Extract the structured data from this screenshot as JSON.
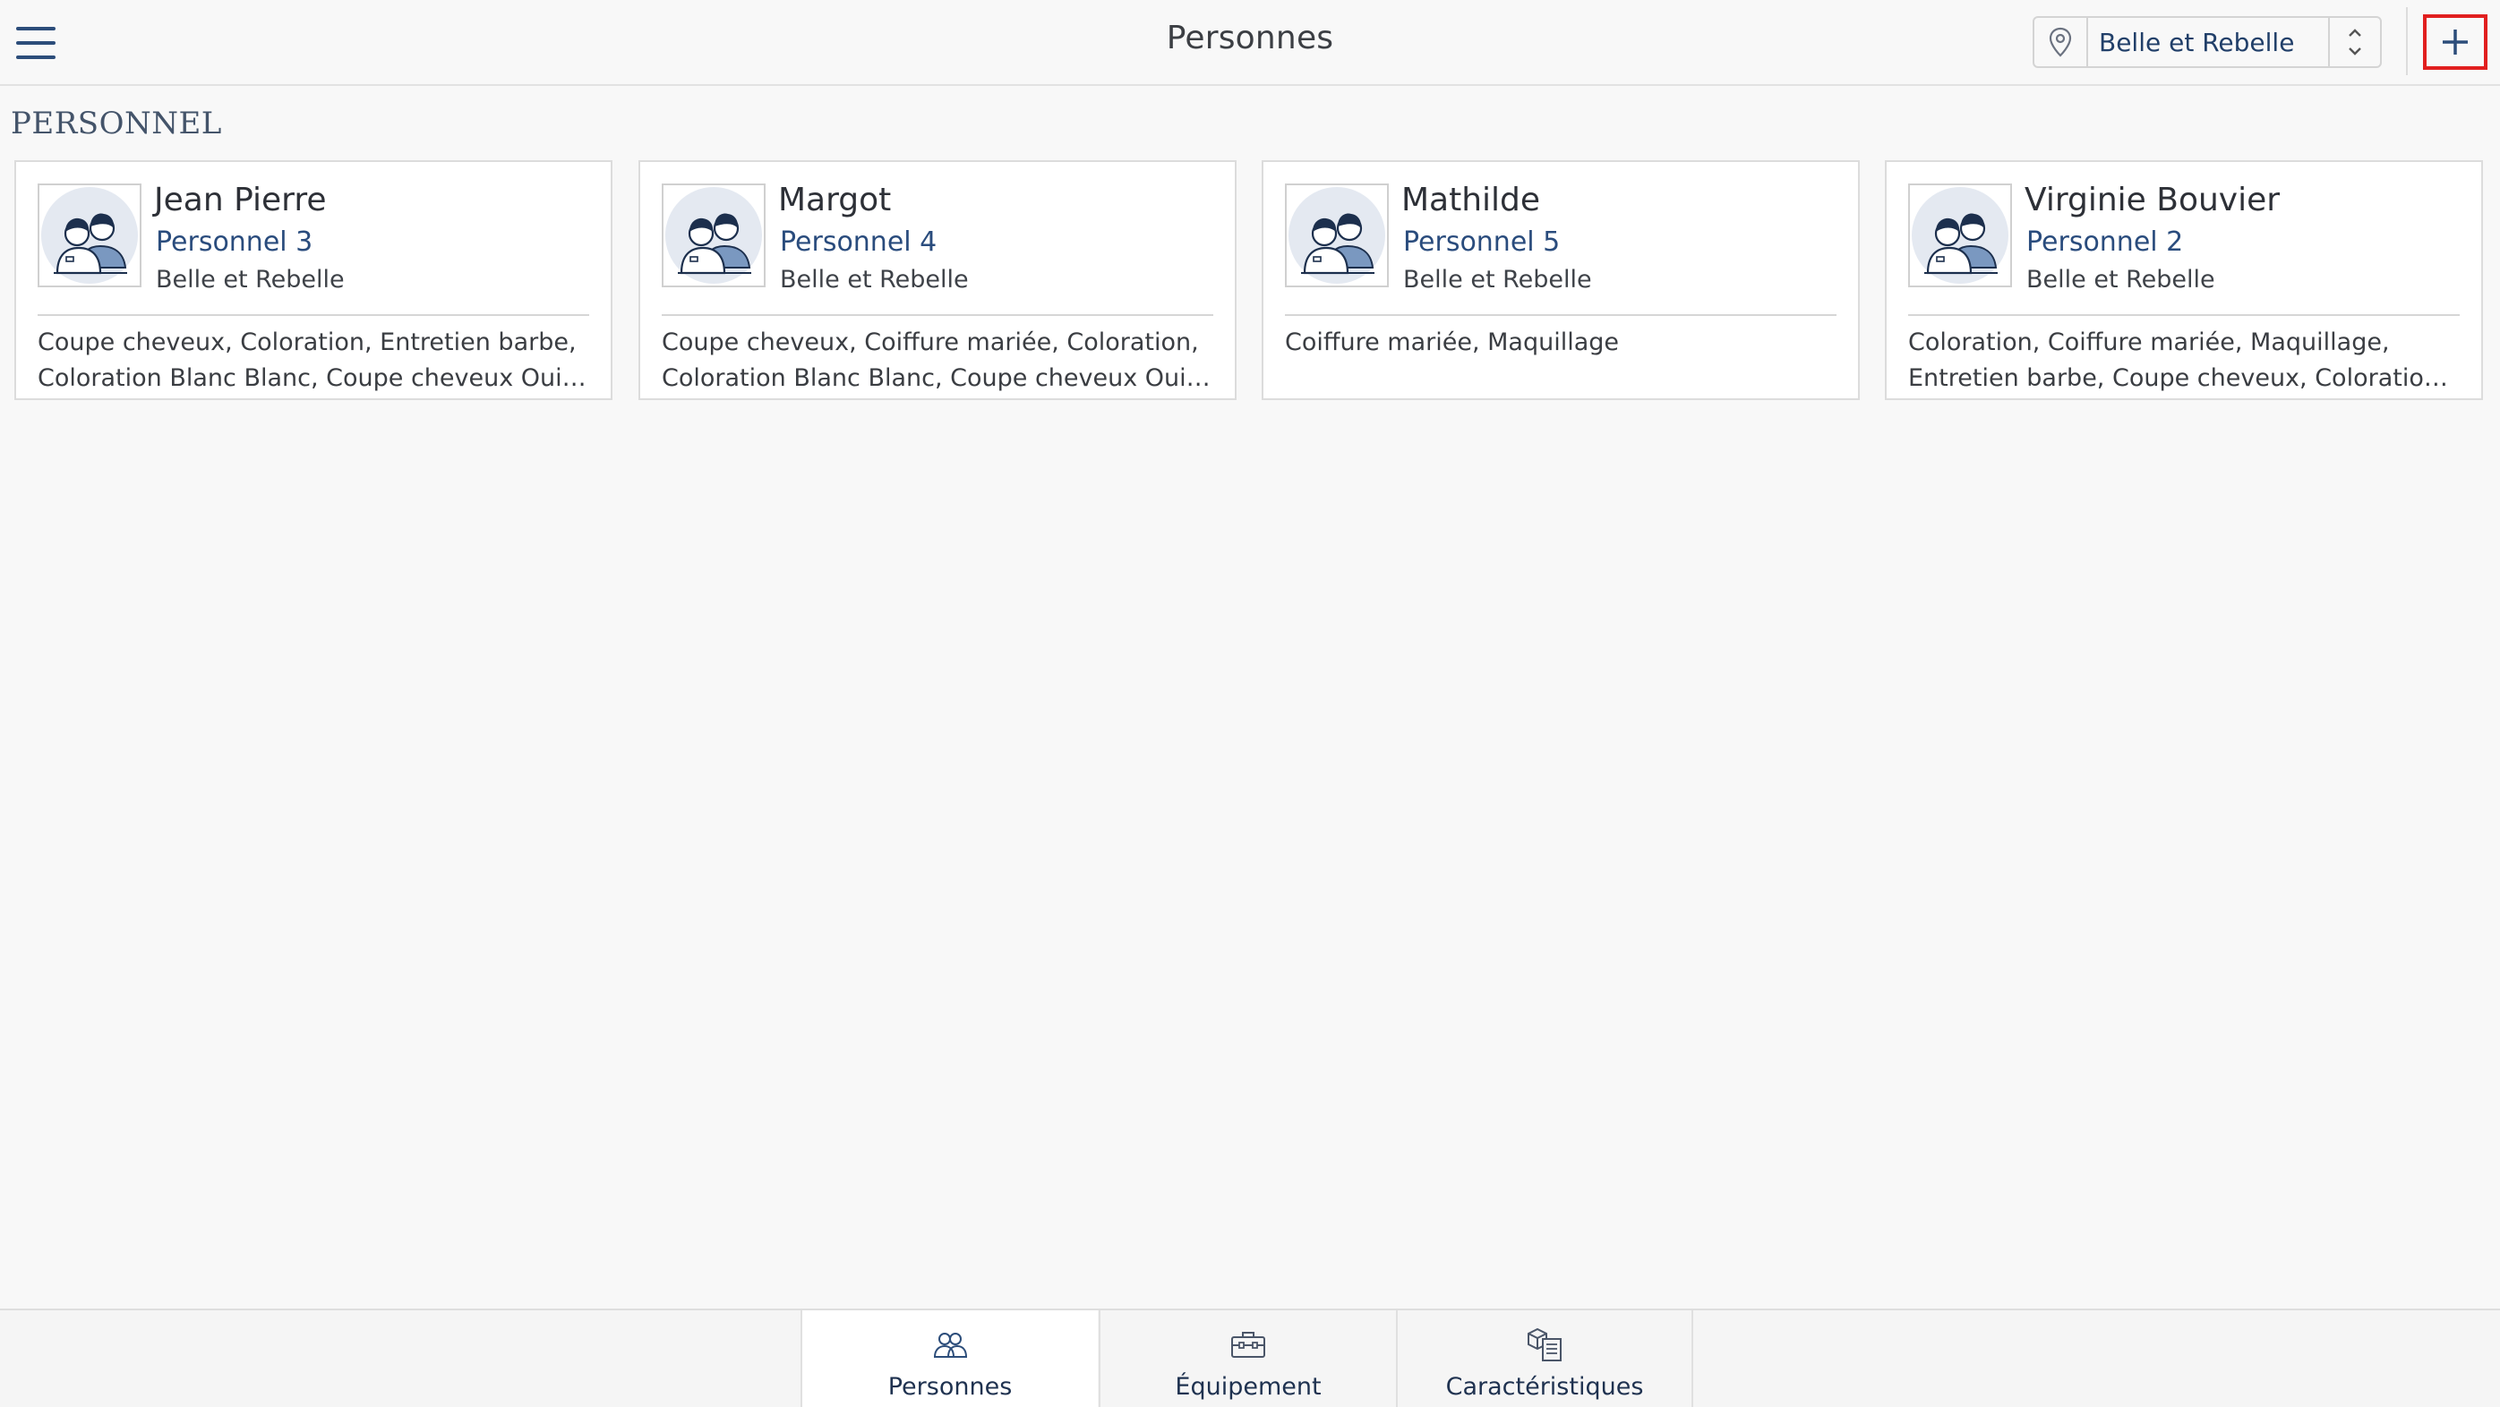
{
  "header": {
    "title": "Personnes",
    "location": "Belle et Rebelle",
    "icons": {
      "menu": "hamburger-menu-icon",
      "location": "location-pin-icon",
      "chevrons": "chevron-up-down-icon",
      "add": "plus-icon"
    }
  },
  "section": {
    "title": "PERSONNEL"
  },
  "cards": [
    {
      "name": "Jean Pierre",
      "role": "Personnel 3",
      "salon": "Belle et Rebelle",
      "services": "Coupe cheveux, Coloration, Entretien barbe, Coloration Blanc Blanc, Coupe cheveux Oui oui"
    },
    {
      "name": "Margot",
      "role": "Personnel 4",
      "salon": "Belle et Rebelle",
      "services": "Coupe cheveux, Coiffure mariée, Coloration, Coloration Blanc Blanc, Coupe cheveux Oui oui"
    },
    {
      "name": "Mathilde",
      "role": "Personnel 5",
      "salon": "Belle et Rebelle",
      "services": "Coiffure mariée, Maquillage"
    },
    {
      "name": "Virginie Bouvier",
      "role": "Personnel 2",
      "salon": "Belle et Rebelle",
      "services": "Coloration, Coiffure mariée, Maquillage, Entretien barbe, Coupe cheveux, Coloration Blanc Blanc, Coupe cheveux Oui oui"
    }
  ],
  "tabs": [
    {
      "label": "Personnes",
      "icon": "people-icon",
      "active": true
    },
    {
      "label": "Équipement",
      "icon": "toolbox-icon",
      "active": false
    },
    {
      "label": "Caractéristiques",
      "icon": "characteristics-icon",
      "active": false
    }
  ],
  "colors": {
    "accent": "#2c4d7a",
    "highlight": "#e11f1f",
    "background": "#f8f8f8"
  }
}
